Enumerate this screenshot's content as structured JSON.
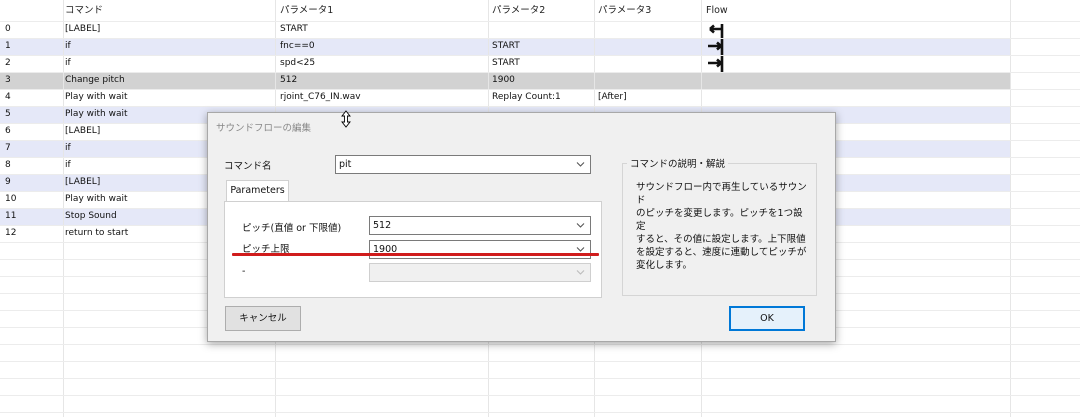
{
  "grid": {
    "headers": [
      "コマンド",
      "パラメータ1",
      "パラメータ2",
      "パラメータ3",
      "Flow"
    ],
    "rows": [
      {
        "index": "0",
        "command": "[LABEL]",
        "p1": "START",
        "p2": "",
        "p3": "",
        "flow": "arrow-left"
      },
      {
        "index": "1",
        "command": "if",
        "p1": "fnc==0",
        "p2": "START",
        "p3": "",
        "flow": "arrow-right"
      },
      {
        "index": "2",
        "command": "if",
        "p1": "spd<25",
        "p2": "START",
        "p3": "",
        "flow": "arrow-right"
      },
      {
        "index": "3",
        "command": "Change pitch",
        "p1": "512",
        "p2": "1900",
        "p3": "",
        "flow": ""
      },
      {
        "index": "4",
        "command": "Play with wait",
        "p1": "rjoint_C76_IN.wav",
        "p2": "Replay Count:1",
        "p3": "[After]",
        "flow": ""
      },
      {
        "index": "5",
        "command": "Play with wait",
        "p1": "",
        "p2": "",
        "p3": "",
        "flow": ""
      },
      {
        "index": "6",
        "command": "[LABEL]",
        "p1": "",
        "p2": "",
        "p3": "",
        "flow": ""
      },
      {
        "index": "7",
        "command": "if",
        "p1": "",
        "p2": "",
        "p3": "",
        "flow": ""
      },
      {
        "index": "8",
        "command": "if",
        "p1": "",
        "p2": "",
        "p3": "",
        "flow": ""
      },
      {
        "index": "9",
        "command": "[LABEL]",
        "p1": "",
        "p2": "",
        "p3": "",
        "flow": ""
      },
      {
        "index": "10",
        "command": "Play with wait",
        "p1": "",
        "p2": "",
        "p3": "",
        "flow": ""
      },
      {
        "index": "11",
        "command": "Stop Sound",
        "p1": "",
        "p2": "",
        "p3": "",
        "flow": ""
      },
      {
        "index": "12",
        "command": "return to start",
        "p1": "",
        "p2": "",
        "p3": "",
        "flow": ""
      }
    ]
  },
  "dialog": {
    "title": "サウンドフローの編集",
    "command_name_label": "コマンド名",
    "command_name_value": "pit",
    "tab_label": "Parameters",
    "param1_label": "ピッチ(直値 or 下限値)",
    "param1_value": "512",
    "param2_label": "ピッチ上限",
    "param2_value": "1900",
    "param3_label": "-",
    "param3_value": "",
    "description_title": "コマンドの説明・解説",
    "description_text": "サウンドフロー内で再生しているサウンド\nのピッチを変更します。ピッチを1つ設定\nすると、その値に設定します。上下限値\nを設定すると、速度に連動してピッチが\n変化します。",
    "cancel_label": "キャンセル",
    "ok_label": "OK"
  },
  "colors": {
    "alt_row": "#e5e8f8",
    "selected_row": "#d2d2d2",
    "annotation_red": "#d01c1c",
    "ok_border": "#0078d7"
  },
  "icons": {
    "flow_left": "arrow-left-icon",
    "flow_right": "arrow-right-icon",
    "dropdown": "chevron-down-icon",
    "cursor": "resize-cursor-icon"
  }
}
